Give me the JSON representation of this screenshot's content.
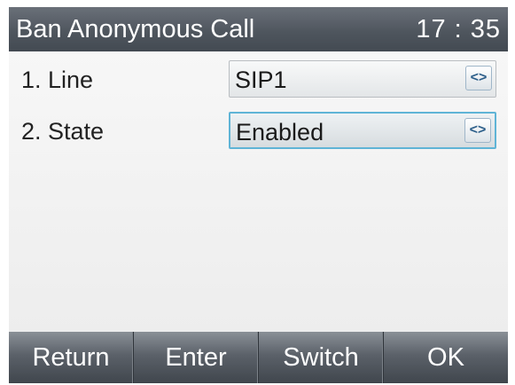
{
  "header": {
    "title": "Ban Anonymous Call",
    "time": "17 : 35"
  },
  "settings": [
    {
      "label": "1.  Line",
      "value": "SIP1",
      "arrow_icon": "left-right-arrow-icon",
      "focused": false
    },
    {
      "label": "2.  State",
      "value": "Enabled",
      "arrow_icon": "left-right-arrow-icon",
      "focused": true
    }
  ],
  "arrow_glyph": "<>",
  "softkeys": [
    "Return",
    "Enter",
    "Switch",
    "OK"
  ],
  "colors": {
    "titlebar": "#4f565e",
    "focus_border": "#5fb4d6",
    "softkey_bar": "#5b6169"
  }
}
